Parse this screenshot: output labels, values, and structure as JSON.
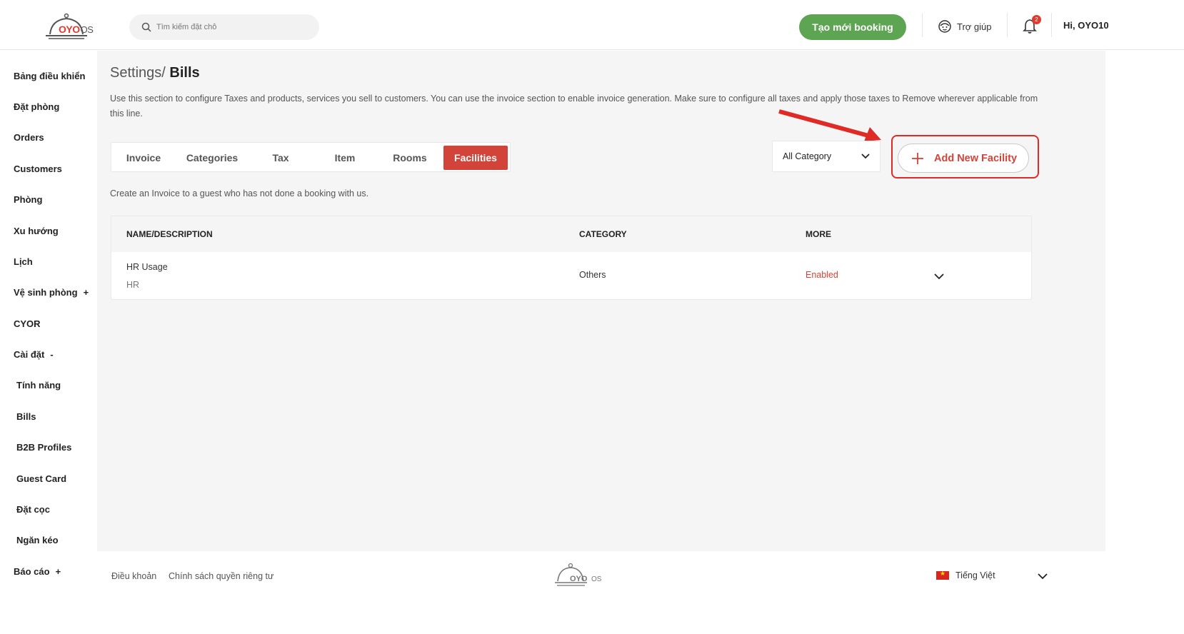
{
  "header": {
    "logo_text": "OYO",
    "logo_suffix": "OS",
    "search_placeholder": "Tìm kiếm đặt chỗ",
    "new_booking_label": "Tạo mới booking",
    "help_label": "Trợ giúp",
    "notification_count": "2",
    "greeting": "Hi, OYO10"
  },
  "sidebar": {
    "items": [
      {
        "label": "Bảng điều khiển"
      },
      {
        "label": "Đặt phòng"
      },
      {
        "label": "Orders"
      },
      {
        "label": "Customers"
      },
      {
        "label": "Phòng"
      },
      {
        "label": "Xu hướng"
      },
      {
        "label": "Lịch"
      },
      {
        "label": "Vệ sinh phòng",
        "mark": "+"
      },
      {
        "label": "CYOR"
      },
      {
        "label": "Cài đặt",
        "mark": "-"
      },
      {
        "label": "Tính năng"
      },
      {
        "label": "Bills"
      },
      {
        "label": "B2B Profiles"
      },
      {
        "label": "Guest Card"
      },
      {
        "label": "Đặt cọc"
      },
      {
        "label": "Ngăn kéo"
      },
      {
        "label": "Báo cáo",
        "mark": "+"
      }
    ]
  },
  "page": {
    "breadcrumb_parent": "Settings",
    "breadcrumb_sep": "/",
    "breadcrumb_current": "Bills",
    "description": "Use this section to configure Taxes and products, services you sell to customers. You can use the invoice section to enable invoice generation. Make sure to configure all taxes and apply those taxes to Remove wherever applicable from this line.",
    "tabs": [
      "Invoice",
      "Categories",
      "Tax",
      "Item",
      "Rooms",
      "Facilities"
    ],
    "active_tab": "Facilities",
    "category_filter": "All Category",
    "add_button_label": "Add New Facility",
    "sub_note": "Create an Invoice to a guest who has not done a booking with us."
  },
  "table": {
    "headers": [
      "NAME/DESCRIPTION",
      "CATEGORY",
      "MORE"
    ],
    "rows": [
      {
        "name": "HR Usage",
        "description": "HR",
        "category": "Others",
        "status": "Enabled"
      }
    ]
  },
  "footer": {
    "terms": "Điều khoản",
    "privacy": "Chính sách quyền riêng tư",
    "language": "Tiếng Việt"
  },
  "colors": {
    "accent": "#d2443a",
    "primary_green": "#5da553",
    "annotation_red": "#e02a26"
  }
}
